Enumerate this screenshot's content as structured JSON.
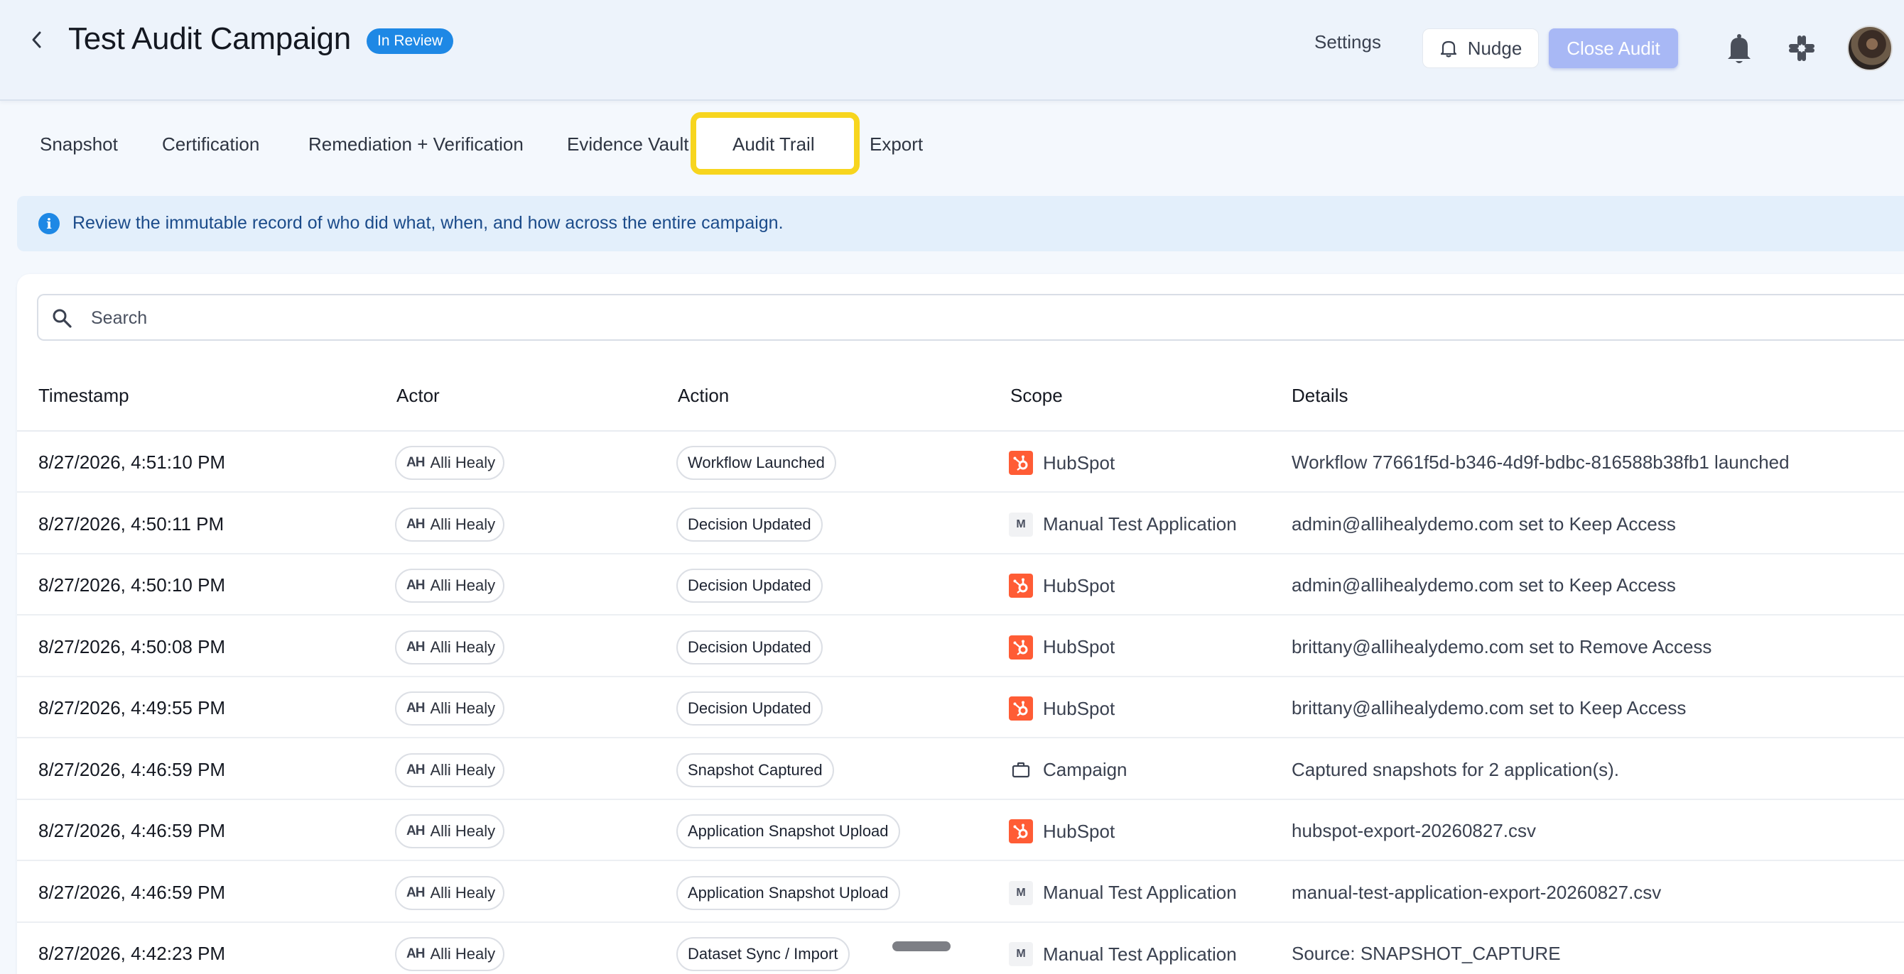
{
  "header": {
    "title": "Test Audit Campaign",
    "status": "In Review",
    "settings_label": "Settings",
    "nudge_label": "Nudge",
    "close_label": "Close Audit",
    "accent_color": "#1e88e5",
    "close_button_color": "#a8b8f5"
  },
  "tabs": [
    {
      "label": "Snapshot"
    },
    {
      "label": "Certification"
    },
    {
      "label": "Remediation + Verification"
    },
    {
      "label": "Evidence Vault"
    },
    {
      "label": "Audit Trail",
      "active": true
    },
    {
      "label": "Export"
    }
  ],
  "info": {
    "text": "Review the immutable record of who did what, when, and how across the entire campaign."
  },
  "search": {
    "placeholder": "Search"
  },
  "table": {
    "columns": [
      "Timestamp",
      "Actor",
      "Action",
      "Scope",
      "Details"
    ],
    "rows": [
      {
        "timestamp": "8/27/2026, 4:51:10 PM",
        "actor_initials": "AH",
        "actor": "Alli Healy",
        "action": "Workflow Launched",
        "scope_icon": "hubspot-logo",
        "scope": "HubSpot",
        "details": "Workflow 77661f5d-b346-4d9f-bdbc-816588b38fb1 launched"
      },
      {
        "timestamp": "8/27/2026, 4:50:11 PM",
        "actor_initials": "AH",
        "actor": "Alli Healy",
        "action": "Decision Updated",
        "scope_icon": "manual-app-logo",
        "scope": "Manual Test Application",
        "details": "admin@allihealydemo.com set to Keep Access"
      },
      {
        "timestamp": "8/27/2026, 4:50:10 PM",
        "actor_initials": "AH",
        "actor": "Alli Healy",
        "action": "Decision Updated",
        "scope_icon": "hubspot-logo",
        "scope": "HubSpot",
        "details": "admin@allihealydemo.com set to Keep Access"
      },
      {
        "timestamp": "8/27/2026, 4:50:08 PM",
        "actor_initials": "AH",
        "actor": "Alli Healy",
        "action": "Decision Updated",
        "scope_icon": "hubspot-logo",
        "scope": "HubSpot",
        "details": "brittany@allihealydemo.com set to Remove Access"
      },
      {
        "timestamp": "8/27/2026, 4:49:55 PM",
        "actor_initials": "AH",
        "actor": "Alli Healy",
        "action": "Decision Updated",
        "scope_icon": "hubspot-logo",
        "scope": "HubSpot",
        "details": "brittany@allihealydemo.com set to Keep Access"
      },
      {
        "timestamp": "8/27/2026, 4:46:59 PM",
        "actor_initials": "AH",
        "actor": "Alli Healy",
        "action": "Snapshot Captured",
        "scope_icon": "briefcase-icon",
        "scope": "Campaign",
        "details": "Captured snapshots for 2 application(s)."
      },
      {
        "timestamp": "8/27/2026, 4:46:59 PM",
        "actor_initials": "AH",
        "actor": "Alli Healy",
        "action": "Application Snapshot Upload",
        "scope_icon": "hubspot-logo",
        "scope": "HubSpot",
        "details": "hubspot-export-20260827.csv"
      },
      {
        "timestamp": "8/27/2026, 4:46:59 PM",
        "actor_initials": "AH",
        "actor": "Alli Healy",
        "action": "Application Snapshot Upload",
        "scope_icon": "manual-app-logo",
        "scope": "Manual Test Application",
        "details": "manual-test-application-export-20260827.csv"
      },
      {
        "timestamp": "8/27/2026, 4:42:23 PM",
        "actor_initials": "AH",
        "actor": "Alli Healy",
        "action": "Dataset Sync / Import",
        "scope_icon": "manual-app-logo",
        "scope": "Manual Test Application",
        "details": "Source: SNAPSHOT_CAPTURE"
      }
    ]
  },
  "manual_logo_letter": "M"
}
